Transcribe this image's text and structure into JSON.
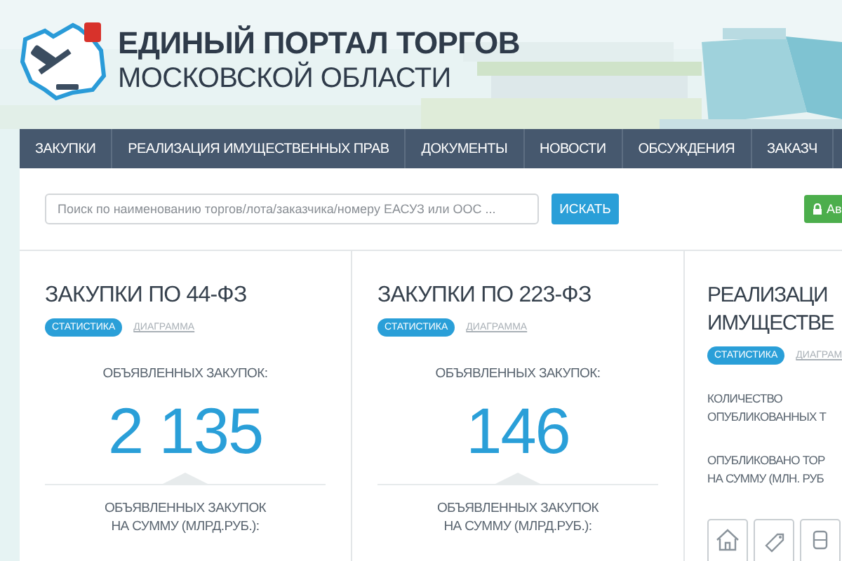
{
  "header": {
    "title": "ЕДИНЫЙ ПОРТАЛ ТОРГОВ",
    "subtitle": "МОСКОВСКОЙ ОБЛАСТИ"
  },
  "nav": [
    {
      "label": "ЗАКУПКИ"
    },
    {
      "label": "РЕАЛИЗАЦИЯ ИМУЩЕСТВЕННЫХ ПРАВ"
    },
    {
      "label": "ДОКУМЕНТЫ"
    },
    {
      "label": "НОВОСТИ"
    },
    {
      "label": "ОБСУЖДЕНИЯ"
    },
    {
      "label": "ЗАКАЗЧ"
    }
  ],
  "search": {
    "placeholder": "Поиск по наименованию торгов/лота/заказчика/номеру ЕАСУЗ или ООС ...",
    "button": "ИСКАТЬ"
  },
  "login_button": {
    "label": "Ав"
  },
  "cards": [
    {
      "kind": "procurement",
      "title_lines": [
        "ЗАКУПКИ ПО 44-ФЗ"
      ],
      "tabs": [
        {
          "label": "СТАТИСТИКА",
          "selected": true
        },
        {
          "label": "ДИАГРАММА",
          "selected": false
        }
      ],
      "stats": [
        {
          "label_lines": [
            "ОБЪЯВЛЕННЫХ ЗАКУПОК:"
          ],
          "value": "2 135"
        },
        {
          "label_lines": [
            "ОБЪЯВЛЕННЫХ ЗАКУПОК",
            "НА СУММУ (МЛРД.РУБ.):"
          ]
        }
      ]
    },
    {
      "kind": "procurement",
      "title_lines": [
        "ЗАКУПКИ ПО 223-ФЗ"
      ],
      "tabs": [
        {
          "label": "СТАТИСТИКА",
          "selected": true
        },
        {
          "label": "ДИАГРАММА",
          "selected": false
        }
      ],
      "stats": [
        {
          "label_lines": [
            "ОБЪЯВЛЕННЫХ ЗАКУПОК:"
          ],
          "value": "146"
        },
        {
          "label_lines": [
            "ОБЪЯВЛЕННЫХ ЗАКУПОК",
            "НА СУММУ (МЛРД.РУБ.):"
          ]
        }
      ]
    },
    {
      "kind": "property",
      "title_lines": [
        "РЕАЛИЗАЦИ",
        "ИМУЩЕСТВЕ"
      ],
      "tabs": [
        {
          "label": "СТАТИСТИКА",
          "selected": true
        },
        {
          "label": "ДИАГРАМ",
          "selected": false
        }
      ],
      "stats": [
        {
          "label_lines": [
            "КОЛИЧЕСТВО",
            "ОПУБЛИКОВАННЫХ Т"
          ]
        },
        {
          "label_lines": [
            "ОПУБЛИКОВАНО ТОР",
            "НА СУММУ (МЛН. РУБ"
          ]
        }
      ]
    }
  ]
}
